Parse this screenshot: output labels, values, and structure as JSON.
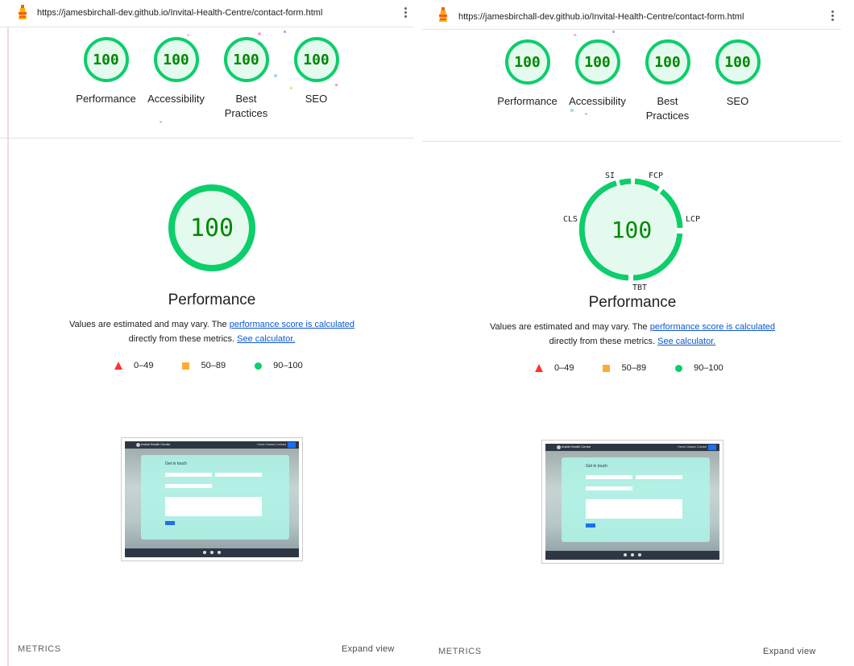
{
  "left": {
    "url": "https://jamesbirchall-dev.github.io/Invital-Health-Centre/contact-form.html",
    "gauges": [
      {
        "score": "100",
        "label": "Performance"
      },
      {
        "score": "100",
        "label": "Accessibility"
      },
      {
        "score": "100",
        "label": "Best Practices"
      },
      {
        "score": "100",
        "label": "SEO"
      }
    ],
    "big_score": "100",
    "title": "Performance",
    "desc_prefix": "Values are estimated and may vary. The ",
    "desc_link": "performance score is calculated",
    "desc_middle": "directly from these metrics. ",
    "desc_link2": "See calculator.",
    "legend": [
      "0–49",
      "50–89",
      "90–100"
    ],
    "metrics_label": "METRICS",
    "expand_label": "Expand view"
  },
  "right": {
    "url": "https://jamesbirchall-dev.github.io/Invital-Health-Centre/contact-form.html",
    "gauges": [
      {
        "score": "100",
        "label": "Performance"
      },
      {
        "score": "100",
        "label": "Accessibility"
      },
      {
        "score": "100",
        "label": "Best Practices"
      },
      {
        "score": "100",
        "label": "SEO"
      }
    ],
    "big_score": "100",
    "metric_labels": {
      "si": "SI",
      "fcp": "FCP",
      "cls": "CLS",
      "lcp": "LCP",
      "tbt": "TBT"
    },
    "title": "Performance",
    "desc_prefix": "Values are estimated and may vary. The ",
    "desc_link": "performance score is calculated",
    "desc_middle": "directly from these metrics. ",
    "desc_link2": "See calculator.",
    "legend": [
      "0–49",
      "50–89",
      "90–100"
    ],
    "metrics_label": "METRICS",
    "expand_label": "Expand view"
  },
  "thumbnail": {
    "brand": "Invital Health Centre",
    "nav_links": "Home  Classes  Contact",
    "heading": "Get in touch"
  },
  "colors": {
    "pass": "#0cce6b",
    "pass_text": "#008800",
    "pass_bg": "#e5faef",
    "fail": "#ff3333",
    "average": "#ffaa33",
    "link": "#0b57d0"
  }
}
